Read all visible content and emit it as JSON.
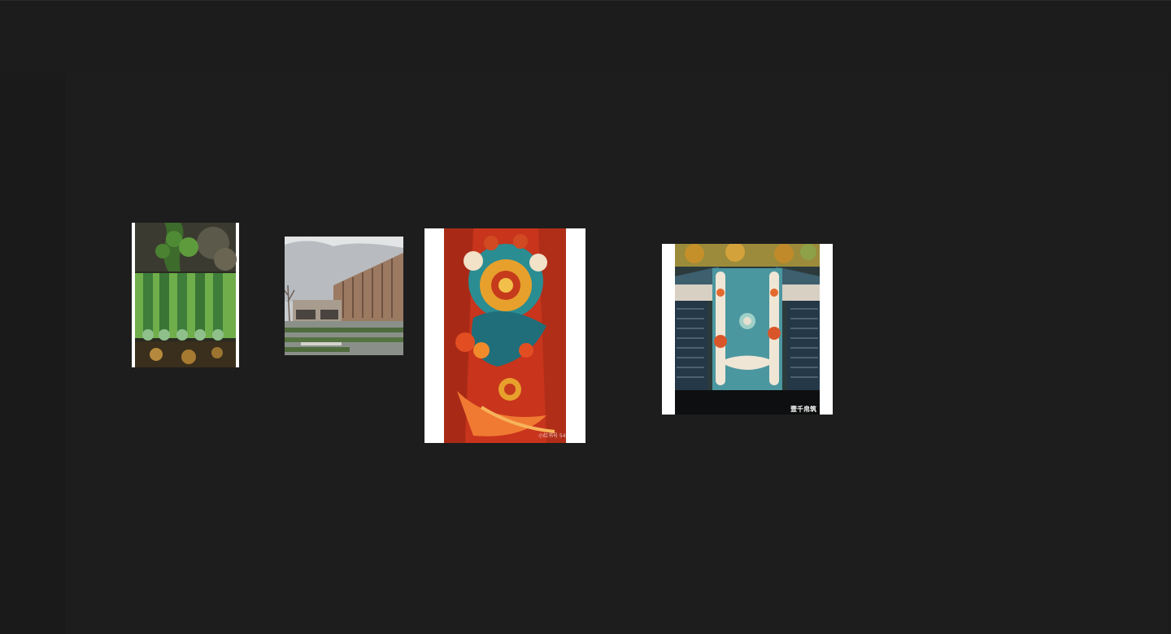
{
  "canvas": {
    "background": "#1d1d1d",
    "border": "#ffffff"
  },
  "images": [
    {
      "subject": "green-glazed-roof-tiles-with-plant",
      "watermark": ""
    },
    {
      "subject": "modern-building-with-courtyard-garden",
      "watermark": ""
    },
    {
      "subject": "colorful-dragon-phoenix-artwork",
      "watermark": "小红书号 5488"
    },
    {
      "subject": "aerial-view-chinese-courtyard-with-dragon",
      "watermark": "壹千帛筑"
    }
  ]
}
